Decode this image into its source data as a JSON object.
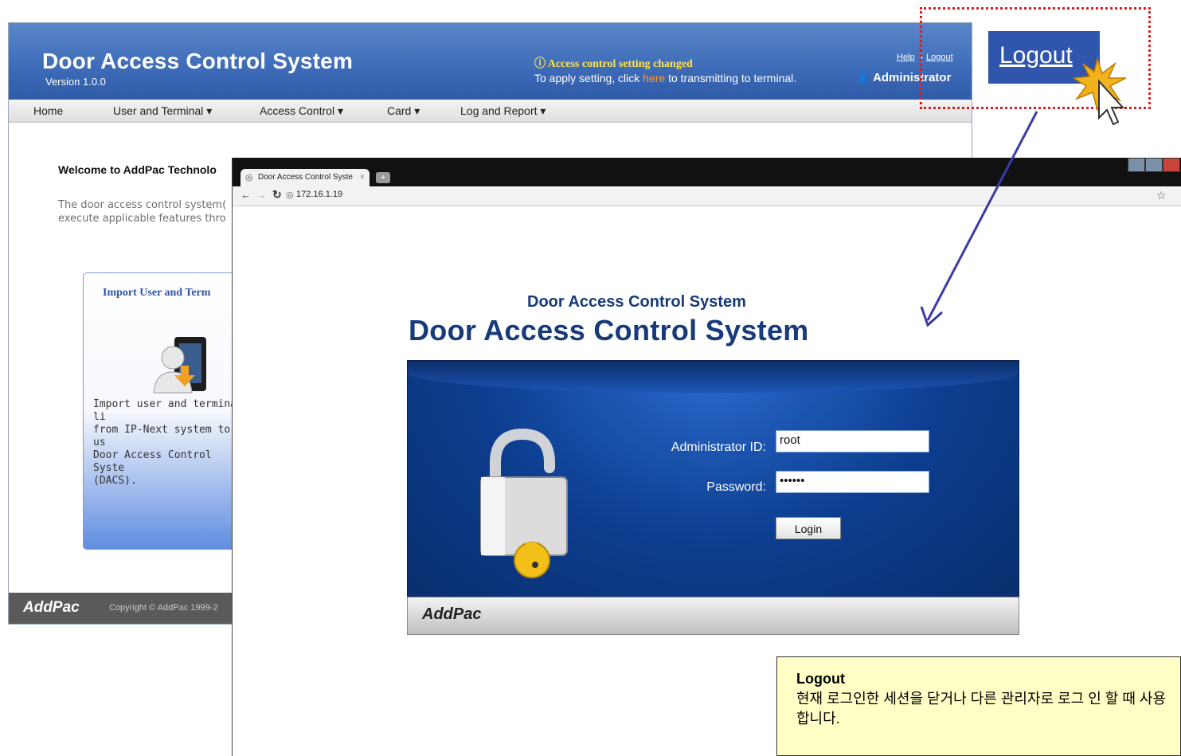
{
  "background_app": {
    "title": "Door Access Control System",
    "version": "Version 1.0.0",
    "notice_title": "ⓘ Access control setting changed",
    "notice_text_before": "To apply setting, click ",
    "notice_link": "here",
    "notice_text_after": " to transmitting to terminal.",
    "help_link": "Help",
    "separator": "|",
    "logout_link": "Logout",
    "admin_name": "Administrator",
    "nav": [
      "Home",
      "User and Terminal ▾",
      "Access Control ▾",
      "Card ▾",
      "Log and Report ▾"
    ],
    "welcome": "Welcome to AddPac Technolo",
    "desc_line1": "The door access control system(",
    "desc_line2": "execute applicable features thro",
    "card_title": "Import User and Term",
    "card_text_lines": [
      "Import user and terminal li",
      "from IP-Next system to us",
      "Door Access Control Syste",
      "(DACS)."
    ],
    "footer_logo": "AddPac",
    "footer_copy": "Copyright © AddPac 1999-2"
  },
  "browser": {
    "tab_title": "Door Access Control Syste",
    "tab_close": "×",
    "new_tab": "+",
    "url": "172.16.1.19",
    "star": "☆"
  },
  "login": {
    "subtitle": "Door Access Control System",
    "title": "Door Access Control System",
    "admin_id_label": "Administrator ID:",
    "admin_id_value": "root",
    "password_label": "Password:",
    "password_value": "••••••",
    "login_button": "Login",
    "brand": "AddPac"
  },
  "callout": {
    "zoom_logout": "Logout",
    "tip_title": "Logout",
    "tip_text": "현재 로그인한 세션을 닫거나 다른 관리자로 로그 인 할 때 사용합니다."
  },
  "colors": {
    "header_blue": "#3d6bb7",
    "login_panel_blue": "#0c3d8e",
    "callout_red": "#e21b1b",
    "arrow": "#3b3ba8",
    "tip_bg": "#ffffc6"
  }
}
